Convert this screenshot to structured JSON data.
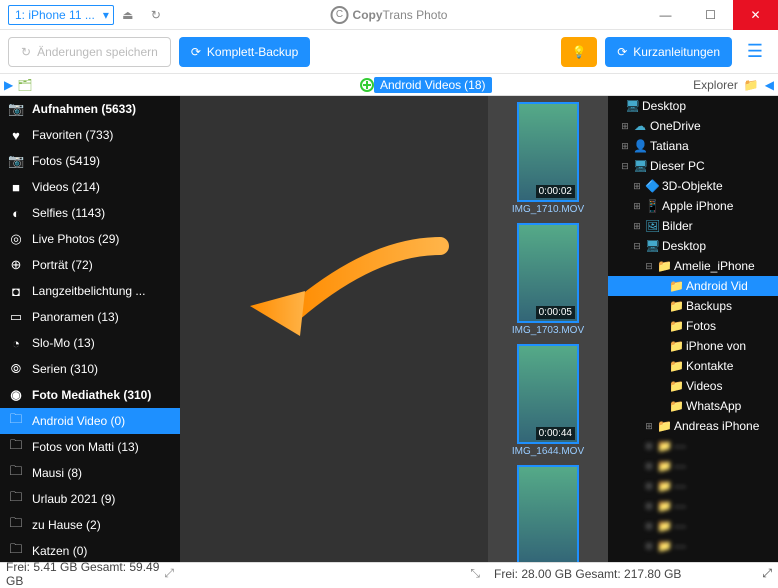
{
  "title": {
    "brand1": "Copy",
    "brand2": "Trans",
    "brand3": " Photo"
  },
  "device": "1: iPhone 11 ...",
  "toolbar": {
    "save": "Änderungen speichern",
    "backup": "Komplett-Backup",
    "guides": "Kurzanleitungen"
  },
  "folder_tag": {
    "name": "Android Videos",
    "count": "(18)"
  },
  "explorer_label": "Explorer",
  "sidebar": [
    {
      "icon": "📷",
      "label": "Aufnahmen (5633)",
      "bold": true
    },
    {
      "icon": "♥",
      "label": "Favoriten (733)"
    },
    {
      "icon": "📷",
      "label": "Fotos (5419)"
    },
    {
      "icon": "■",
      "label": "Videos (214)"
    },
    {
      "icon": "◐",
      "label": "Selfies (1143)"
    },
    {
      "icon": "◎",
      "label": "Live Photos (29)"
    },
    {
      "icon": "⊕",
      "label": "Porträt (72)"
    },
    {
      "icon": "◘",
      "label": "Langzeitbelichtung ..."
    },
    {
      "icon": "▭",
      "label": "Panoramen (13)"
    },
    {
      "icon": "◔",
      "label": "Slo-Mo (13)"
    },
    {
      "icon": "⦾",
      "label": "Serien (310)"
    },
    {
      "icon": "◉",
      "label": "Foto Mediathek (310)",
      "bold": true
    },
    {
      "icon": "🗀",
      "label": "Android Video (0)",
      "selected": true
    },
    {
      "icon": "🗀",
      "label": "Fotos von Matti (13)"
    },
    {
      "icon": "🗀",
      "label": "Mausi (8)"
    },
    {
      "icon": "🗀",
      "label": "Urlaub 2021 (9)"
    },
    {
      "icon": "🗀",
      "label": "zu Hause (2)"
    },
    {
      "icon": "🗀",
      "label": "Katzen (0)"
    }
  ],
  "thumbs": [
    {
      "time": "0:00:02",
      "name": "IMG_1710.MOV"
    },
    {
      "time": "0:00:05",
      "name": "IMG_1703.MOV"
    },
    {
      "time": "0:00:44",
      "name": "IMG_1644.MOV"
    },
    {
      "time": "",
      "name": ""
    }
  ],
  "tree": [
    {
      "pad": 4,
      "exp": "",
      "icon": "🖥",
      "label": "Desktop",
      "color": "#4ac"
    },
    {
      "pad": 12,
      "exp": "⊞",
      "icon": "☁",
      "label": "OneDrive",
      "color": "#4ac"
    },
    {
      "pad": 12,
      "exp": "⊞",
      "icon": "👤",
      "label": "Tatiana",
      "color": "#c99"
    },
    {
      "pad": 12,
      "exp": "⊟",
      "icon": "🖥",
      "label": "Dieser PC",
      "color": "#4ac"
    },
    {
      "pad": 24,
      "exp": "⊞",
      "icon": "🔷",
      "label": "3D-Objekte",
      "color": "#4ac"
    },
    {
      "pad": 24,
      "exp": "⊞",
      "icon": "📱",
      "label": "Apple iPhone",
      "color": "#888"
    },
    {
      "pad": 24,
      "exp": "⊞",
      "icon": "🖼",
      "label": "Bilder",
      "color": "#4ac"
    },
    {
      "pad": 24,
      "exp": "⊟",
      "icon": "🖥",
      "label": "Desktop",
      "color": "#4ac"
    },
    {
      "pad": 36,
      "exp": "⊟",
      "icon": "📁",
      "label": "Amelie_iPhone",
      "cls": "folder-y"
    },
    {
      "pad": 48,
      "exp": "",
      "icon": "📁",
      "label": "Android Vid",
      "cls": "folder-y",
      "selected": true
    },
    {
      "pad": 48,
      "exp": "",
      "icon": "📁",
      "label": "Backups",
      "cls": "folder-y"
    },
    {
      "pad": 48,
      "exp": "",
      "icon": "📁",
      "label": "Fotos",
      "cls": "folder-y"
    },
    {
      "pad": 48,
      "exp": "",
      "icon": "📁",
      "label": "iPhone von",
      "cls": "folder-y"
    },
    {
      "pad": 48,
      "exp": "",
      "icon": "📁",
      "label": "Kontakte",
      "cls": "folder-y"
    },
    {
      "pad": 48,
      "exp": "",
      "icon": "📁",
      "label": "Videos",
      "cls": "folder-y"
    },
    {
      "pad": 48,
      "exp": "",
      "icon": "📁",
      "label": "WhatsApp",
      "cls": "folder-y"
    },
    {
      "pad": 36,
      "exp": "⊞",
      "icon": "📁",
      "label": "Andreas iPhone",
      "cls": "folder-y"
    },
    {
      "pad": 36,
      "exp": "⊞",
      "icon": "📁",
      "label": "···",
      "cls": "folder-y",
      "blurred": true
    },
    {
      "pad": 36,
      "exp": "⊞",
      "icon": "📁",
      "label": "···",
      "cls": "folder-y",
      "blurred": true
    },
    {
      "pad": 36,
      "exp": "⊞",
      "icon": "📁",
      "label": "···",
      "cls": "folder-y",
      "blurred": true
    },
    {
      "pad": 36,
      "exp": "⊞",
      "icon": "📁",
      "label": "···",
      "cls": "folder-y",
      "blurred": true
    },
    {
      "pad": 36,
      "exp": "⊞",
      "icon": "📁",
      "label": "···",
      "cls": "folder-y",
      "blurred": true
    },
    {
      "pad": 36,
      "exp": "⊞",
      "icon": "📁",
      "label": "···",
      "cls": "folder-y",
      "blurred": true
    }
  ],
  "status": {
    "left": "Frei: 5.41 GB Gesamt: 59.49 GB",
    "right": "Frei: 28.00 GB Gesamt: 217.80 GB"
  }
}
